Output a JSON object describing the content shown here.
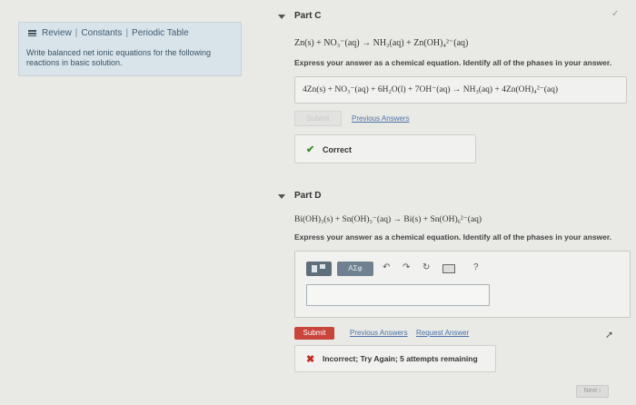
{
  "sidebar": {
    "links": [
      "Review",
      "Constants",
      "Periodic Table"
    ],
    "instructions": "Write balanced net ionic equations for the following reactions in basic solution."
  },
  "partC": {
    "title": "Part C",
    "equation": "Zn(s) + NO₃⁻(aq) → NH₃(aq) + Zn(OH)₄²⁻(aq)",
    "prompt": "Express your answer as a chemical equation. Identify all of the phases in your answer.",
    "answer": "4Zn(s) + NO₃⁻(aq) + 6H₂O(l) + 7OH⁻(aq) → NH₃(aq) + 4Zn(OH)₄²⁻(aq)",
    "submit_label": "Submit",
    "previous_answers_label": "Previous Answers",
    "feedback": "Correct"
  },
  "partD": {
    "title": "Part D",
    "equation": "Bi(OH)₃(s) + Sn(OH)₃⁻(aq) → Bi(s) + Sn(OH)₆²⁻(aq)",
    "prompt": "Express your answer as a chemical equation. Identify all of the phases in your answer.",
    "toolbar": {
      "greek_label": "ΑΣφ",
      "help_label": "?"
    },
    "input_value": "",
    "submit_label": "Submit",
    "previous_answers_label": "Previous Answers",
    "request_answer_label": "Request Answer",
    "feedback": "Incorrect; Try Again; 5 attempts remaining"
  },
  "next_label": "Next ›"
}
